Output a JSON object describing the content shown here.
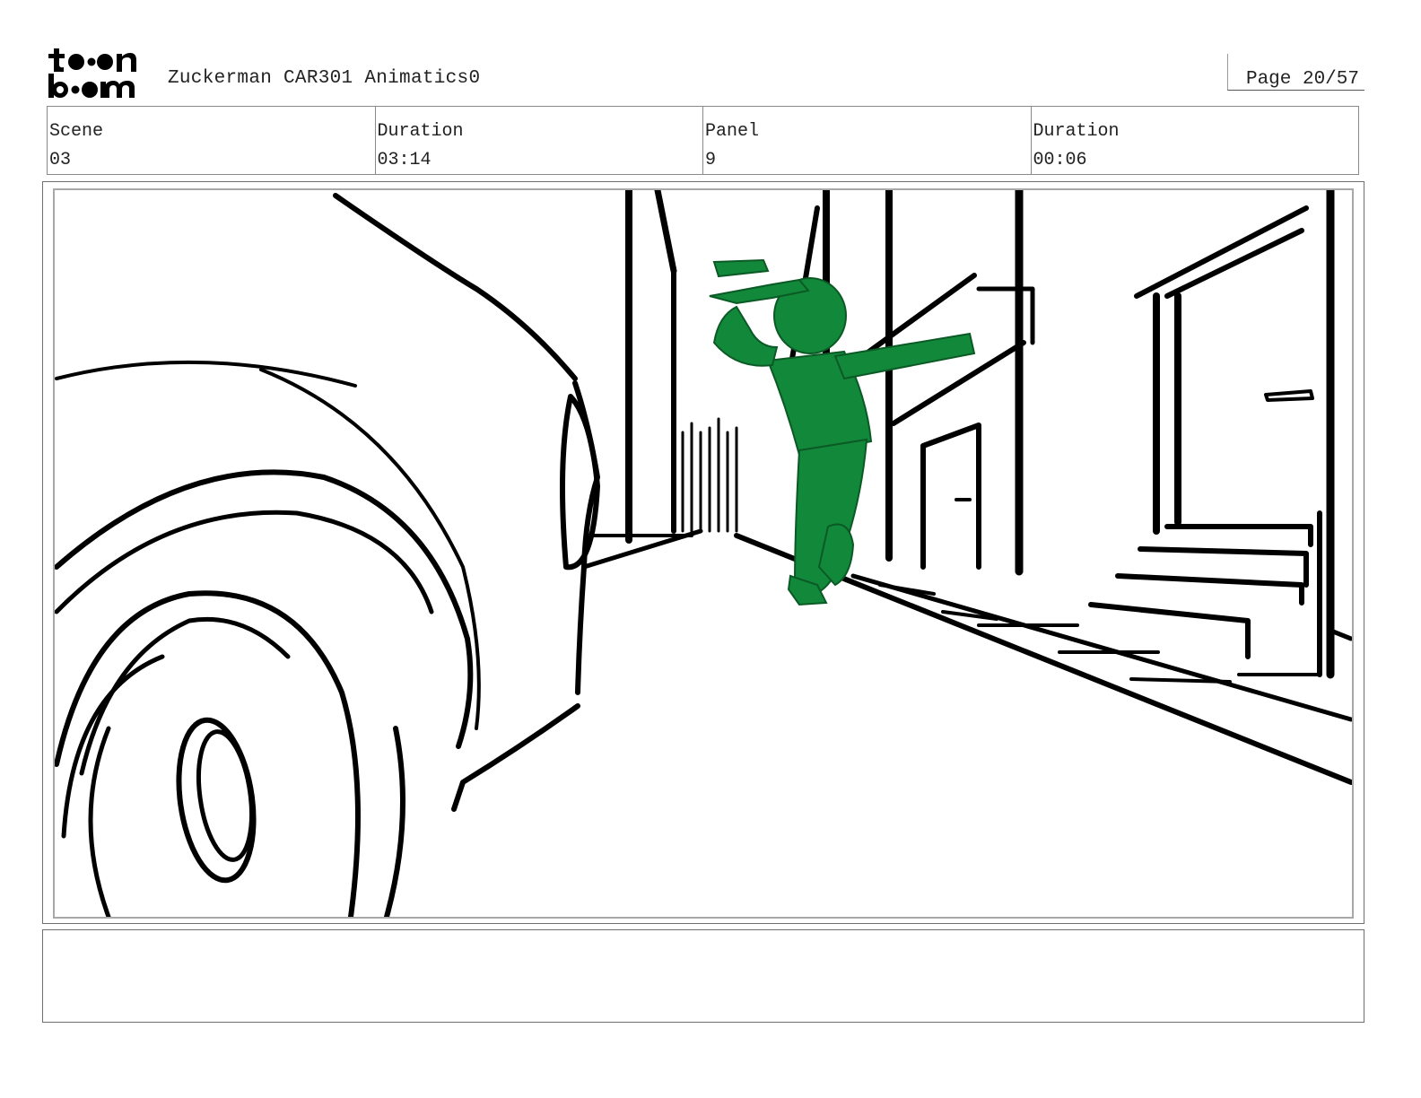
{
  "header": {
    "logo_text": "toonboom",
    "project_title": "Zuckerman CAR301 Animatics0",
    "page_label": "Page 20/57"
  },
  "info": {
    "scene": {
      "label": "Scene",
      "value": "03"
    },
    "scene_duration": {
      "label": "Duration",
      "value": "03:14"
    },
    "panel": {
      "label": "Panel",
      "value": "9"
    },
    "panel_duration": {
      "label": "Duration",
      "value": "00:06"
    }
  },
  "panel": {
    "line_color": "#000000",
    "character_color": "#12883a"
  },
  "notes": {
    "text": ""
  }
}
